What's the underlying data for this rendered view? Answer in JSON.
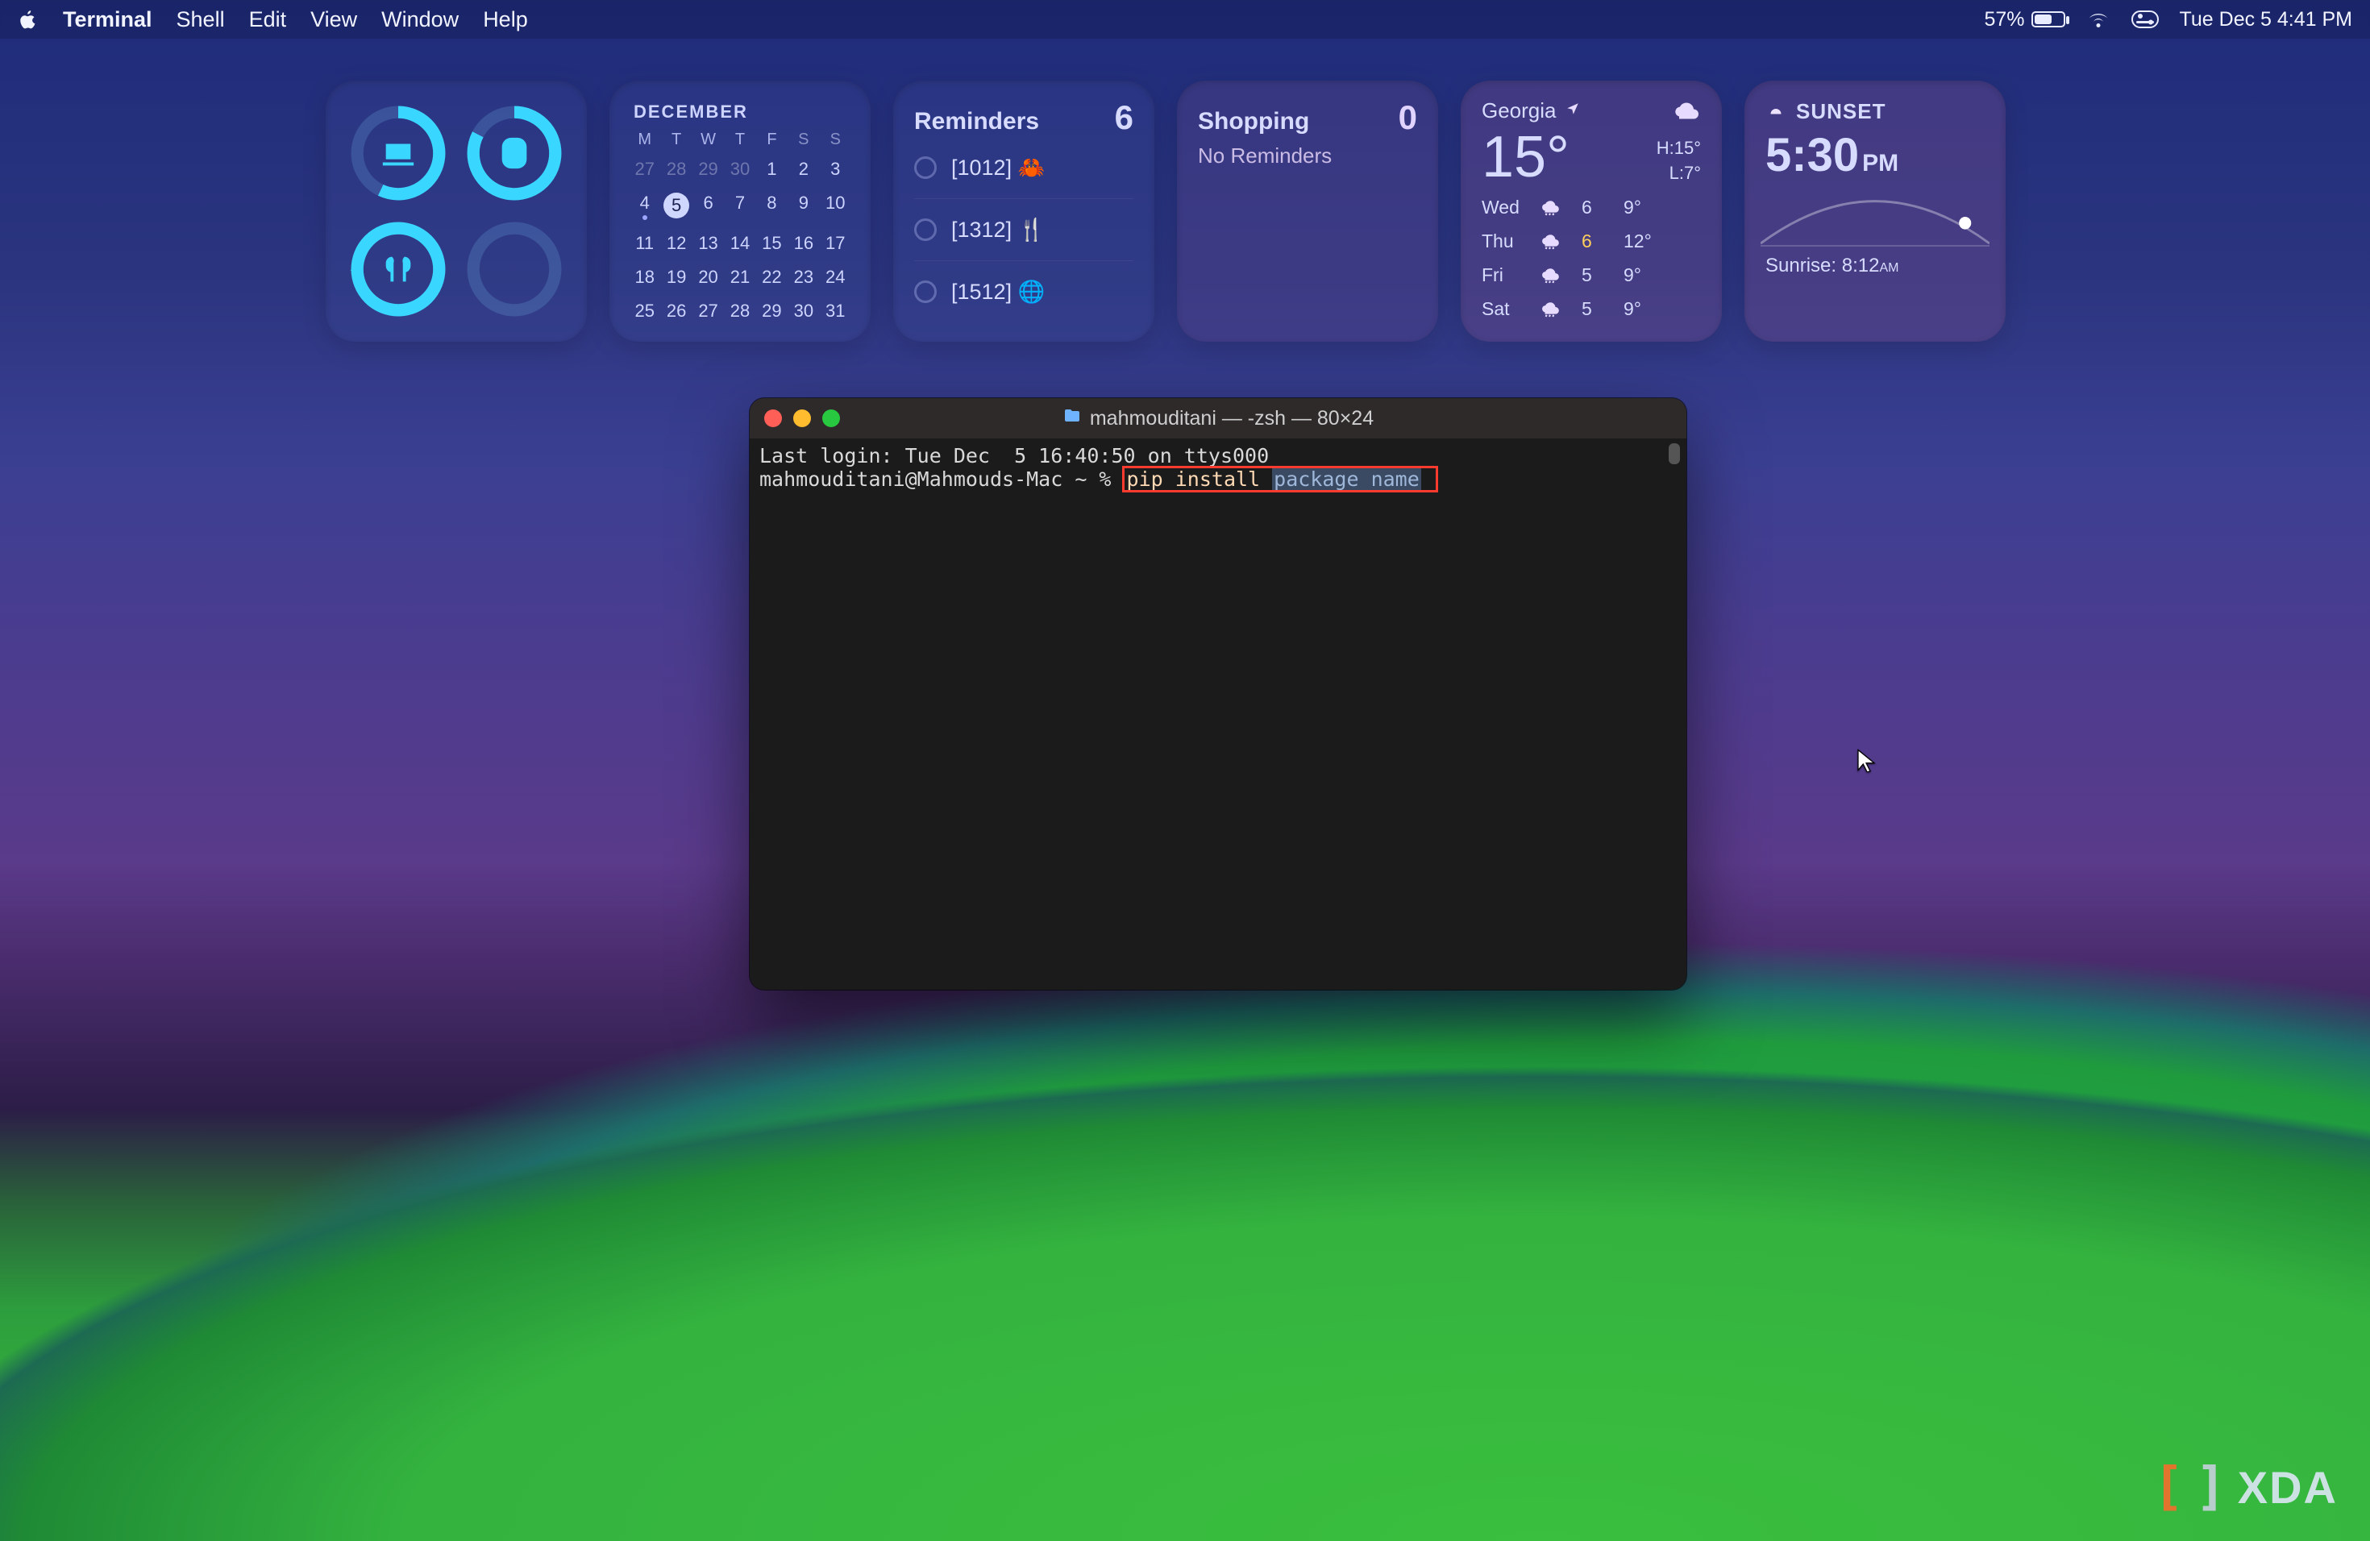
{
  "menubar": {
    "app": "Terminal",
    "items": [
      "Shell",
      "Edit",
      "View",
      "Window",
      "Help"
    ],
    "battery_pct": "57%",
    "clock": "Tue Dec 5  4:41 PM"
  },
  "widgets": {
    "calendar": {
      "month": "DECEMBER",
      "dow": [
        "M",
        "T",
        "W",
        "T",
        "F",
        "S",
        "S"
      ],
      "leading_prev": [
        "27",
        "28",
        "29",
        "30"
      ],
      "days": [
        "1",
        "2",
        "3",
        "4",
        "5",
        "6",
        "7",
        "8",
        "9",
        "10",
        "11",
        "12",
        "13",
        "14",
        "15",
        "16",
        "17",
        "18",
        "19",
        "20",
        "21",
        "22",
        "23",
        "24",
        "25",
        "26",
        "27",
        "28",
        "29",
        "30",
        "31"
      ],
      "today_index": 4,
      "dot_index": 3
    },
    "reminders": {
      "title": "Reminders",
      "count": "6",
      "items": [
        {
          "text": "[1012]",
          "emoji": "🦀"
        },
        {
          "text": "[1312]",
          "emoji": "🍴"
        },
        {
          "text": "[1512]",
          "emoji": "🌐"
        }
      ]
    },
    "shopping": {
      "title": "Shopping",
      "count": "0",
      "empty": "No Reminders"
    },
    "weather": {
      "location": "Georgia",
      "temp": "15°",
      "hi": "H:15°",
      "lo": "L:7°",
      "days": [
        {
          "d": "Wed",
          "lo": "6",
          "hi": "9°",
          "warn": false
        },
        {
          "d": "Thu",
          "lo": "6",
          "hi": "12°",
          "warn": true
        },
        {
          "d": "Fri",
          "lo": "5",
          "hi": "9°",
          "warn": false
        },
        {
          "d": "Sat",
          "lo": "5",
          "hi": "9°",
          "warn": false
        }
      ]
    },
    "clock": {
      "title": "SUNSET",
      "time": "5:30",
      "ampm": "PM",
      "sunrise_label": "Sunrise:",
      "sunrise": "8:12",
      "sunrise_ampm": "AM"
    }
  },
  "terminal": {
    "title": "mahmouditani — -zsh — 80×24",
    "line1": "Last login: Tue Dec  5 16:40:50 on ttys000",
    "prompt": "mahmouditani@Mahmouds-Mac ~ % ",
    "cmd1": "pip install ",
    "cmd2": "package_name"
  },
  "watermark": "XDA"
}
